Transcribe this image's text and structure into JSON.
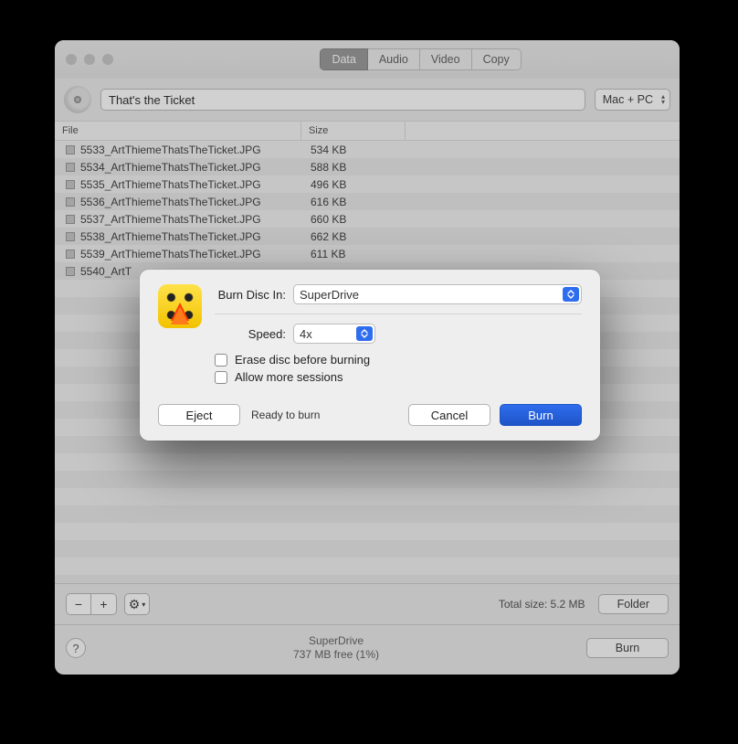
{
  "tabs": {
    "data": "Data",
    "audio": "Audio",
    "video": "Video",
    "copy": "Copy"
  },
  "disc_name": "That's the Ticket",
  "format": "Mac + PC",
  "columns": {
    "file": "File",
    "size": "Size"
  },
  "files": [
    {
      "name": "5533_ArtThiemeThatsTheTicket.JPG",
      "size": "534 KB"
    },
    {
      "name": "5534_ArtThiemeThatsTheTicket.JPG",
      "size": "588 KB"
    },
    {
      "name": "5535_ArtThiemeThatsTheTicket.JPG",
      "size": "496 KB"
    },
    {
      "name": "5536_ArtThiemeThatsTheTicket.JPG",
      "size": "616 KB"
    },
    {
      "name": "5537_ArtThiemeThatsTheTicket.JPG",
      "size": "660 KB"
    },
    {
      "name": "5538_ArtThiemeThatsTheTicket.JPG",
      "size": "662 KB"
    },
    {
      "name": "5539_ArtThiemeThatsTheTicket.JPG",
      "size": "611 KB"
    },
    {
      "name": "5540_ArtT",
      "size": ""
    }
  ],
  "bottom": {
    "total": "Total size: 5.2 MB",
    "folder_btn": "Folder",
    "burn_btn": "Burn",
    "drive": "SuperDrive",
    "free": "737 MB free (1%)"
  },
  "sheet": {
    "burn_in_label": "Burn Disc In:",
    "burn_in_value": "SuperDrive",
    "speed_label": "Speed:",
    "speed_value": "4x",
    "erase": "Erase disc before burning",
    "allow": "Allow more sessions",
    "eject": "Eject",
    "status": "Ready to burn",
    "cancel": "Cancel",
    "burn": "Burn"
  },
  "glyphs": {
    "minus": "−",
    "plus": "+",
    "gear": "⚙",
    "help": "?"
  }
}
